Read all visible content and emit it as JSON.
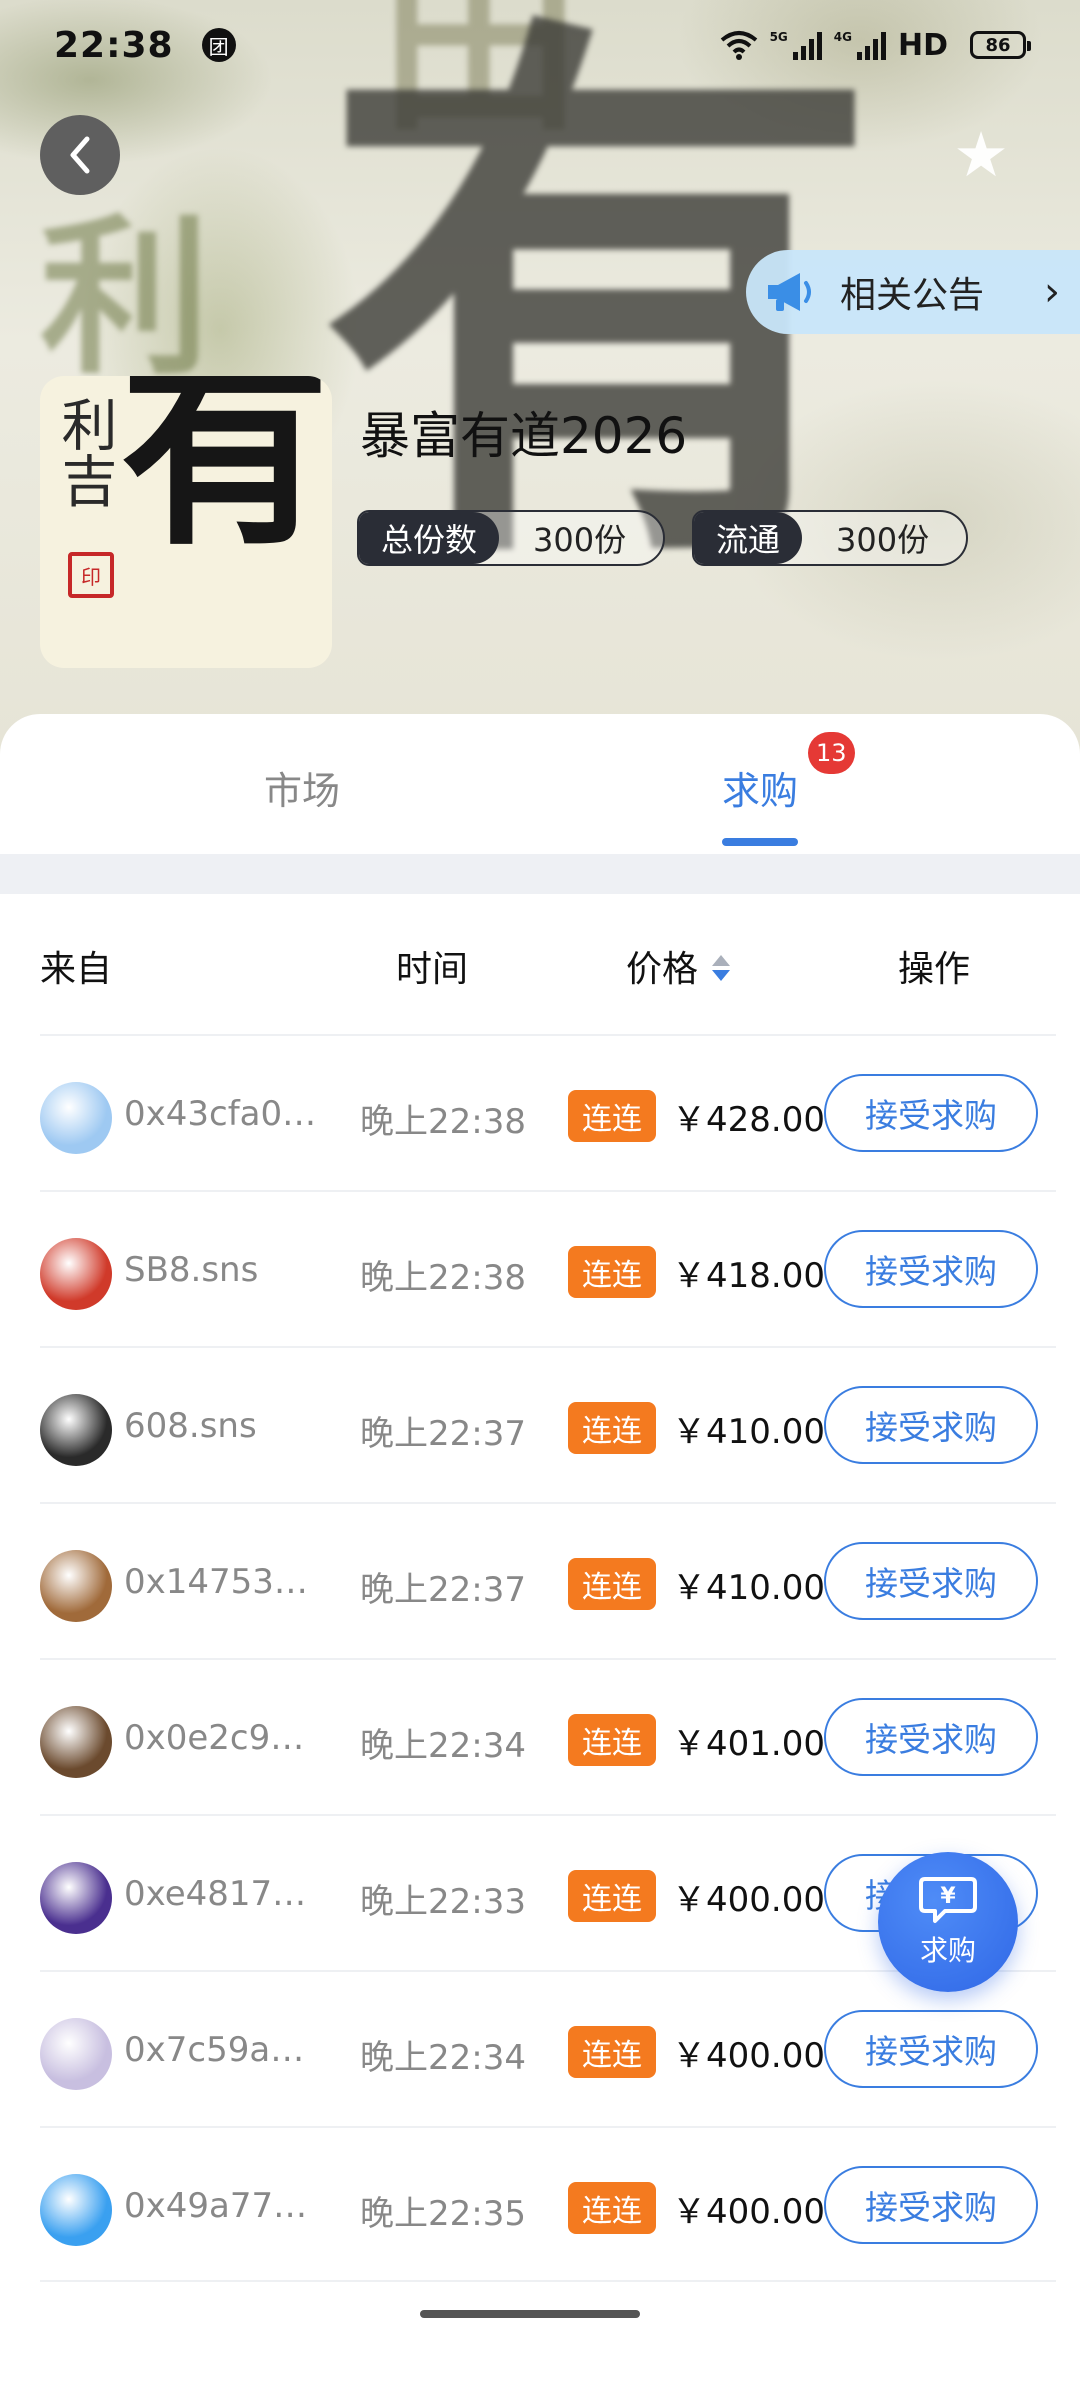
{
  "status_bar": {
    "time": "22:38",
    "app_badge": "团",
    "network_tags": [
      "5G",
      "4G"
    ],
    "hd_label": "HD",
    "battery": "86"
  },
  "header": {
    "back_icon": "chevron-left-icon",
    "favorite_icon": "star-icon",
    "notice_label": "相关公告",
    "notice_icon": "megaphone-icon"
  },
  "asset": {
    "cover_glyph": "有",
    "cover_side_text": "利吉",
    "cover_seal": "印",
    "title": "暴富有道2026",
    "total_shares_label": "总份数",
    "total_shares_value": "300份",
    "circulating_label": "流通",
    "circulating_value": "300份"
  },
  "tabs": [
    {
      "label": "市场",
      "active": false
    },
    {
      "label": "求购",
      "active": true,
      "badge": "13"
    }
  ],
  "table": {
    "headers": {
      "from": "来自",
      "time": "时间",
      "price": "价格",
      "action": "操作"
    },
    "sort": "price-descending",
    "rows": [
      {
        "from": "0x43cfa0a…",
        "time": "晚上22:38",
        "tag": "连连",
        "price": "￥428.00",
        "action": "接受求购",
        "avatar_color": "#9ec9f2"
      },
      {
        "from": "SB8.sns",
        "time": "晚上22:38",
        "tag": "连连",
        "price": "￥418.00",
        "action": "接受求购",
        "avatar_color": "#d03a2a"
      },
      {
        "from": "608.sns",
        "time": "晚上22:37",
        "tag": "连连",
        "price": "￥410.00",
        "action": "接受求购",
        "avatar_color": "#2a2a2a"
      },
      {
        "from": "0x14753b0…",
        "time": "晚上22:37",
        "tag": "连连",
        "price": "￥410.00",
        "action": "接受求购",
        "avatar_color": "#a06a3a"
      },
      {
        "from": "0x0e2c987…",
        "time": "晚上22:34",
        "tag": "连连",
        "price": "￥401.00",
        "action": "接受求购",
        "avatar_color": "#6b4a2e"
      },
      {
        "from": "0xe481796…",
        "time": "晚上22:33",
        "tag": "连连",
        "price": "￥400.00",
        "action": "接受求购",
        "avatar_color": "#4a2f8f"
      },
      {
        "from": "0x7c59a9e…",
        "time": "晚上22:34",
        "tag": "连连",
        "price": "￥400.00",
        "action": "接受求购",
        "avatar_color": "#c8bfe0"
      },
      {
        "from": "0x49a77d8…",
        "time": "晚上22:35",
        "tag": "连连",
        "price": "￥400.00",
        "action": "接受求购",
        "avatar_color": "#3aa0f0"
      }
    ]
  },
  "fab": {
    "label": "求购",
    "icon": "yen-chat-bubble-icon"
  },
  "colors": {
    "accent": "#3a7de0",
    "tag_orange": "#f47a1f",
    "badge_red": "#e53935",
    "pill_dark": "#2a2d36"
  }
}
